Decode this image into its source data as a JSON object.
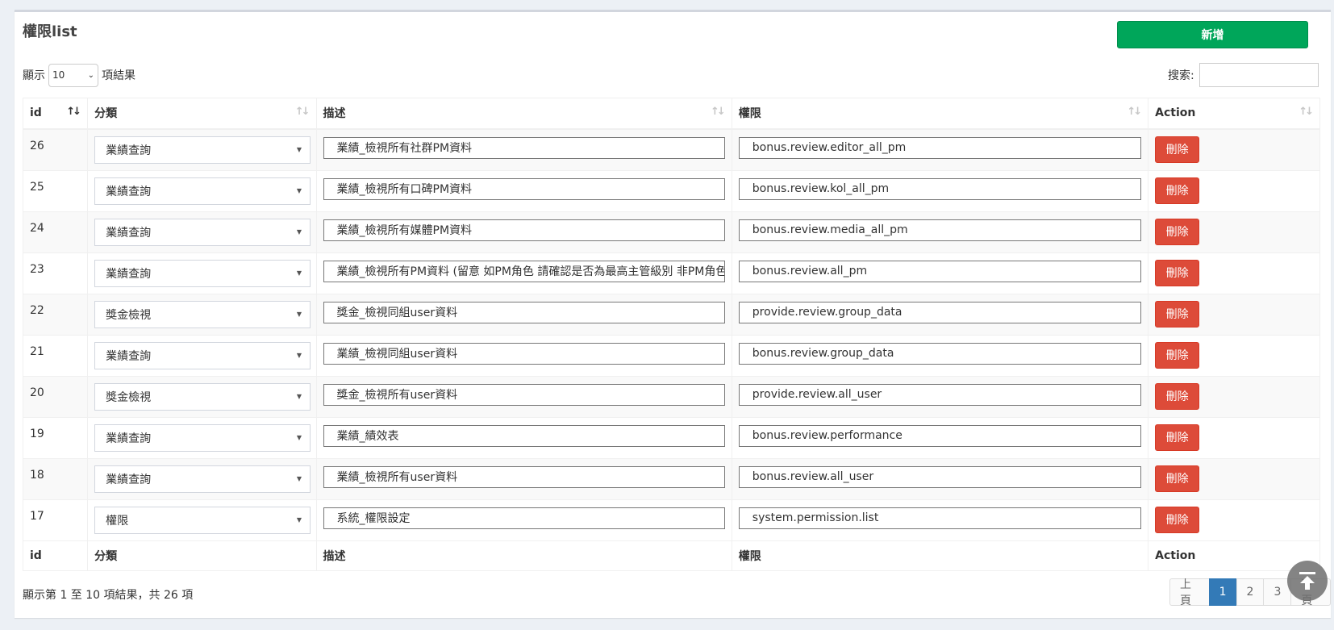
{
  "header": {
    "title": "權限list",
    "add_label": "新增"
  },
  "length": {
    "prefix": "顯示",
    "selected": "10",
    "suffix": "項結果"
  },
  "search": {
    "label": "搜索:",
    "value": ""
  },
  "columns": [
    "id",
    "分類",
    "描述",
    "權限",
    "Action"
  ],
  "rows": [
    {
      "id": "26",
      "category": "業績查詢",
      "description": "業績_檢視所有社群PM資料",
      "permission": "bonus.review.editor_all_pm",
      "action": "刪除"
    },
    {
      "id": "25",
      "category": "業績查詢",
      "description": "業績_檢視所有口碑PM資料",
      "permission": "bonus.review.kol_all_pm",
      "action": "刪除"
    },
    {
      "id": "24",
      "category": "業績查詢",
      "description": "業績_檢視所有媒體PM資料",
      "permission": "bonus.review.media_all_pm",
      "action": "刪除"
    },
    {
      "id": "23",
      "category": "業績查詢",
      "description": "業績_檢視所有PM資料 (留意 如PM角色 請確認是否為最高主管級別 非PM角色",
      "permission": "bonus.review.all_pm",
      "action": "刪除"
    },
    {
      "id": "22",
      "category": "獎金檢視",
      "description": "獎金_檢視同組user資料",
      "permission": "provide.review.group_data",
      "action": "刪除"
    },
    {
      "id": "21",
      "category": "業績查詢",
      "description": "業績_檢視同組user資料",
      "permission": "bonus.review.group_data",
      "action": "刪除"
    },
    {
      "id": "20",
      "category": "獎金檢視",
      "description": "獎金_檢視所有user資料",
      "permission": "provide.review.all_user",
      "action": "刪除"
    },
    {
      "id": "19",
      "category": "業績查詢",
      "description": "業績_績效表",
      "permission": "bonus.review.performance",
      "action": "刪除"
    },
    {
      "id": "18",
      "category": "業績查詢",
      "description": "業績_檢視所有user資料",
      "permission": "bonus.review.all_user",
      "action": "刪除"
    },
    {
      "id": "17",
      "category": "權限",
      "description": "系統_權限設定",
      "permission": "system.permission.list",
      "action": "刪除"
    }
  ],
  "footer": {
    "info": "顯示第 1 至 10 項結果，共 26 項"
  },
  "pagination": {
    "prev": "上頁",
    "pages": [
      "1",
      "2",
      "3"
    ],
    "current": "1",
    "next": "下頁"
  },
  "icons": {
    "scroll_top": "scroll-to-top-icon",
    "sort": "sort-icon"
  },
  "colors": {
    "add_button": "#00a65a",
    "delete_button": "#dd4b39",
    "active_page": "#337ab7"
  }
}
